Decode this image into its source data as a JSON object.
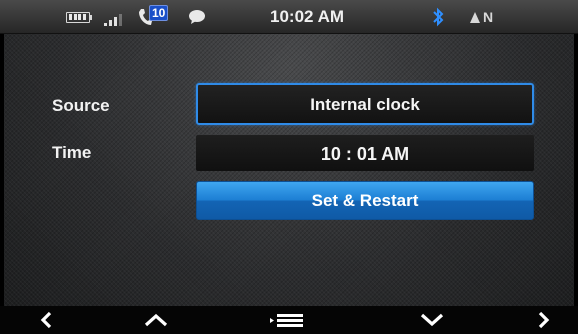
{
  "status_bar": {
    "battery_icon": "battery-icon",
    "signal_icon": "signal-icon",
    "phone_icon": "phone-icon",
    "missed_calls": "10",
    "message_icon": "message-icon",
    "clock": "10:02 AM",
    "bluetooth_icon": "bluetooth-icon",
    "compass_heading": "N"
  },
  "form": {
    "source_label": "Source",
    "source_value": "Internal clock",
    "time_label": "Time",
    "time_value": "10 : 01 AM",
    "set_restart_label": "Set & Restart"
  },
  "bottom_nav": {
    "back_icon": "chevron-left-icon",
    "up_icon": "chevron-up-icon",
    "menu_icon": "menu-icon",
    "down_icon": "chevron-down-icon",
    "forward_icon": "chevron-right-icon"
  },
  "colors": {
    "accent_blue": "#2f8be8",
    "button_blue": "#1d7fd4",
    "badge_blue": "#1a4fc8",
    "bluetooth_blue": "#2f8fff"
  }
}
